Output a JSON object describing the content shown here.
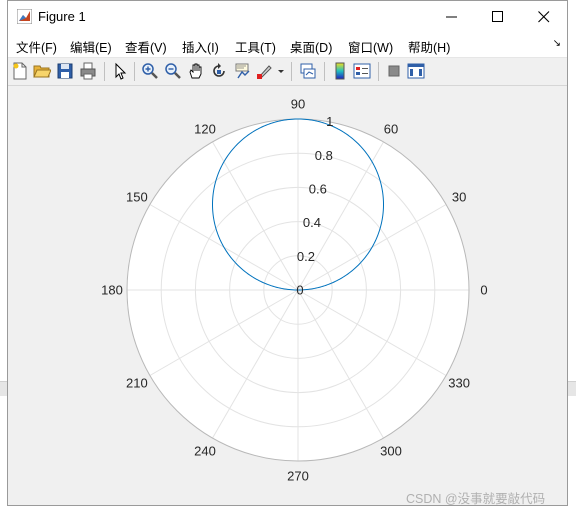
{
  "window": {
    "title": "Figure 1"
  },
  "menu": {
    "items": [
      "文件(F)",
      "编辑(E)",
      "查看(V)",
      "插入(I)",
      "工具(T)",
      "桌面(D)",
      "窗口(W)",
      "帮助(H)"
    ],
    "corner": "↘"
  },
  "toolbar": {
    "icons": [
      "new-figure-icon",
      "open-file-icon",
      "save-icon",
      "print-icon",
      "pointer-icon",
      "zoom-in-icon",
      "zoom-out-icon",
      "pan-icon",
      "rotate-3d-icon",
      "data-cursor-icon",
      "brush-icon",
      "dropdown-arrow-icon",
      "link-plot-icon",
      "colorbar-icon",
      "legend-icon",
      "hide-plot-tools-icon",
      "show-plot-tools-icon"
    ]
  },
  "chart_data": {
    "type": "polar-line",
    "theta_ticks": [
      "0",
      "30",
      "60",
      "90",
      "120",
      "150",
      "180",
      "210",
      "240",
      "270",
      "300",
      "330"
    ],
    "r_ticks": [
      "0",
      "0.2",
      "0.4",
      "0.6",
      "0.8",
      "1"
    ],
    "rlim": [
      0,
      1
    ],
    "series": [
      {
        "function": "r = sin(theta)",
        "color": "#0072bd"
      }
    ],
    "grid": true
  },
  "watermark": "CSDN @没事就要敲代码"
}
